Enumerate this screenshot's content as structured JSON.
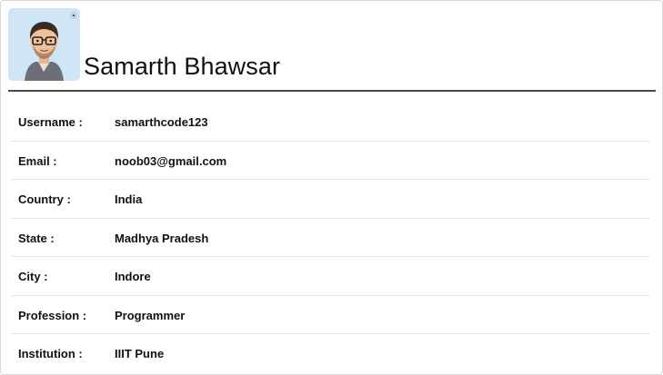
{
  "profile": {
    "name": "Samarth Bhawsar",
    "avatar_icon": "avatar-icon",
    "avatar_bg": "#cfe6f6"
  },
  "details": [
    {
      "label": "Username :",
      "value": "samarthcode123"
    },
    {
      "label": "Email :",
      "value": "noob03@gmail.com"
    },
    {
      "label": "Country :",
      "value": "India"
    },
    {
      "label": "State :",
      "value": "Madhya Pradesh"
    },
    {
      "label": "City :",
      "value": "Indore"
    },
    {
      "label": "Profession :",
      "value": "Programmer"
    },
    {
      "label": "Institution :",
      "value": "IIIT Pune"
    }
  ],
  "colors": {
    "divider": "#4a4a4a",
    "row_border": "#e4e4e4"
  }
}
